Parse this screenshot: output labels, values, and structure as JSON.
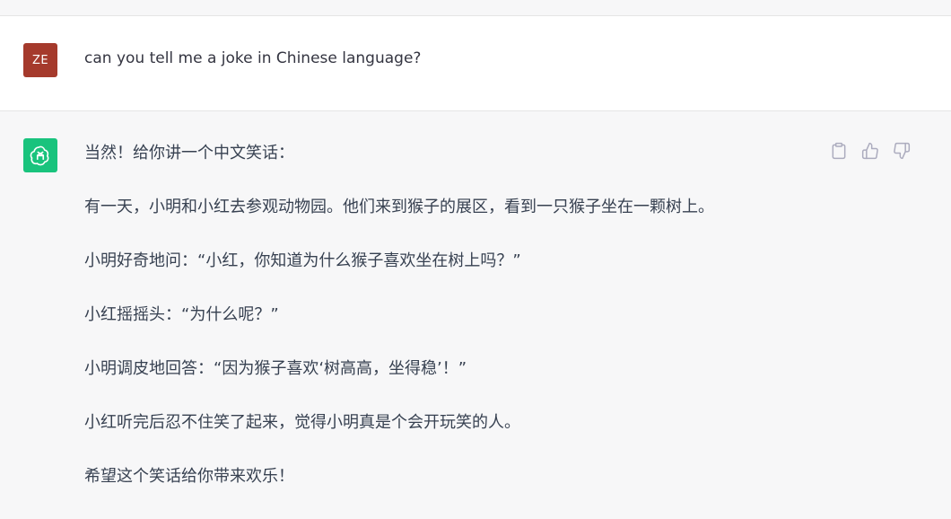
{
  "conversation": {
    "user": {
      "avatar_initials": "ZE",
      "avatar_color": "#a53a2c",
      "message": "can you tell me a joke in Chinese language?"
    },
    "assistant": {
      "avatar_icon": "openai-logo-icon",
      "avatar_color": "#19c37d",
      "paragraphs": [
        "当然！给你讲一个中文笑话：",
        "有一天，小明和小红去参观动物园。他们来到猴子的展区，看到一只猴子坐在一颗树上。",
        "小明好奇地问：“小红，你知道为什么猴子喜欢坐在树上吗？”",
        "小红摇摇头：“为什么呢？”",
        "小明调皮地回答：“因为猴子喜欢‘树高高，坐得稳’！”",
        "小红听完后忍不住笑了起来，觉得小明真是个会开玩笑的人。",
        "希望这个笑话给你带来欢乐！"
      ],
      "actions": [
        {
          "icon": "clipboard-icon"
        },
        {
          "icon": "thumbs-up-icon"
        },
        {
          "icon": "thumbs-down-icon"
        }
      ]
    }
  }
}
